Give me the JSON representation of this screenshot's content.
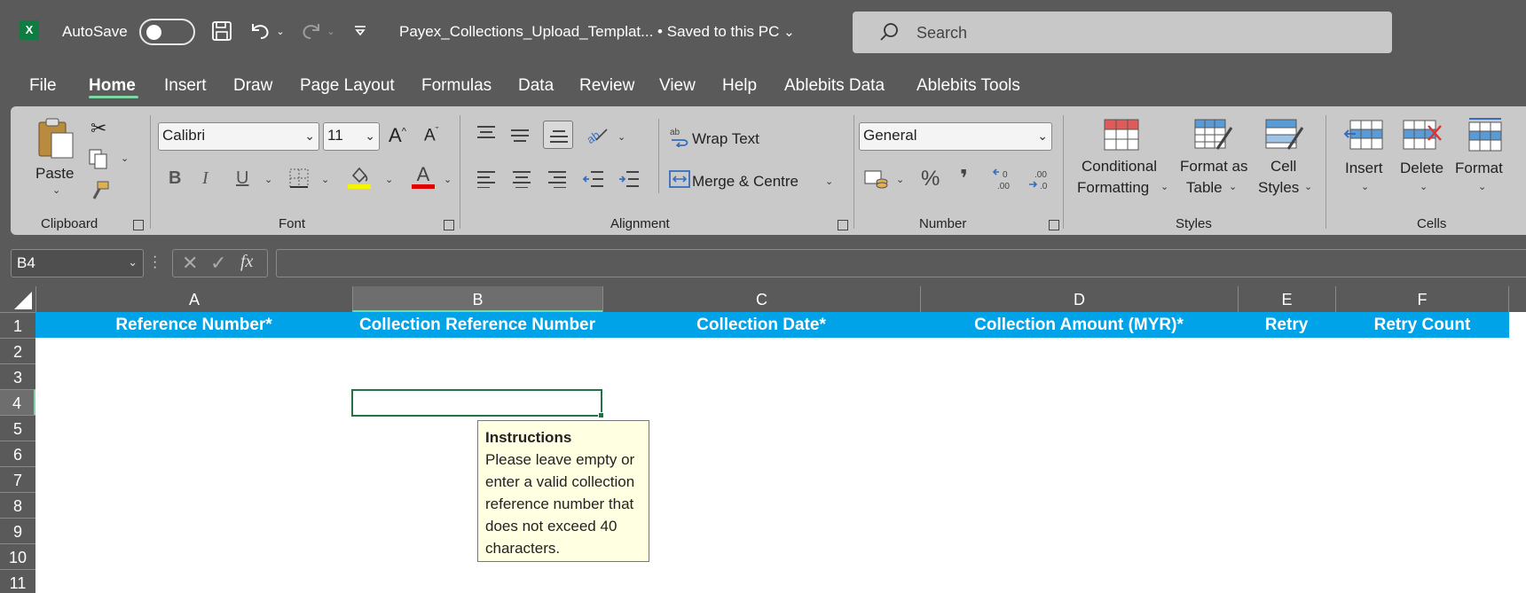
{
  "titlebar": {
    "app_logo": "X",
    "autosave_label": "AutoSave",
    "autosave_on": false,
    "document_title": "Payex_Collections_Upload_Templat...  •  Saved to this PC",
    "search_placeholder": "Search"
  },
  "tabs": [
    "File",
    "Home",
    "Insert",
    "Draw",
    "Page Layout",
    "Formulas",
    "Data",
    "Review",
    "View",
    "Help",
    "Ablebits Data",
    "Ablebits Tools"
  ],
  "active_tab": "Home",
  "ribbon": {
    "clipboard": {
      "paste_label": "Paste",
      "group_label": "Clipboard"
    },
    "font": {
      "font_name": "Calibri",
      "font_size": "11",
      "group_label": "Font",
      "bold": "B",
      "italic": "I",
      "underline": "U",
      "grow": "A",
      "shrink": "A",
      "font_color_letter": "A"
    },
    "alignment": {
      "wrap_text": "Wrap Text",
      "merge_centre": "Merge & Centre",
      "group_label": "Alignment"
    },
    "number": {
      "format": "General",
      "percent": "%",
      "comma": "❜",
      "group_label": "Number"
    },
    "styles": {
      "conditional_line1": "Conditional",
      "conditional_line2": "Formatting",
      "format_table_line1": "Format as",
      "format_table_line2": "Table",
      "cell_styles_line1": "Cell",
      "cell_styles_line2": "Styles",
      "group_label": "Styles"
    },
    "cells": {
      "insert": "Insert",
      "delete": "Delete",
      "format": "Format",
      "group_label": "Cells"
    },
    "colors": {
      "highlight": "#f5f500",
      "font_color": "#e00000"
    }
  },
  "formula_bar": {
    "name_box": "B4",
    "fx": "fx",
    "formula": ""
  },
  "grid": {
    "columns": [
      "A",
      "B",
      "C",
      "D",
      "E",
      "F"
    ],
    "rows": [
      "1",
      "2",
      "3",
      "4",
      "5",
      "6",
      "7",
      "8",
      "9",
      "10",
      "11"
    ],
    "header_row": [
      "Reference Number*",
      "Collection Reference Number",
      "Collection Date*",
      "Collection Amount (MYR)*",
      "Retry",
      "Retry Count"
    ],
    "header_fill": "#00a2e8",
    "active_cell": "B4"
  },
  "comment": {
    "title": "Instructions",
    "lines": [
      "Please leave empty or",
      "enter a valid collection",
      "reference number that",
      "does not exceed 40",
      "characters."
    ]
  }
}
